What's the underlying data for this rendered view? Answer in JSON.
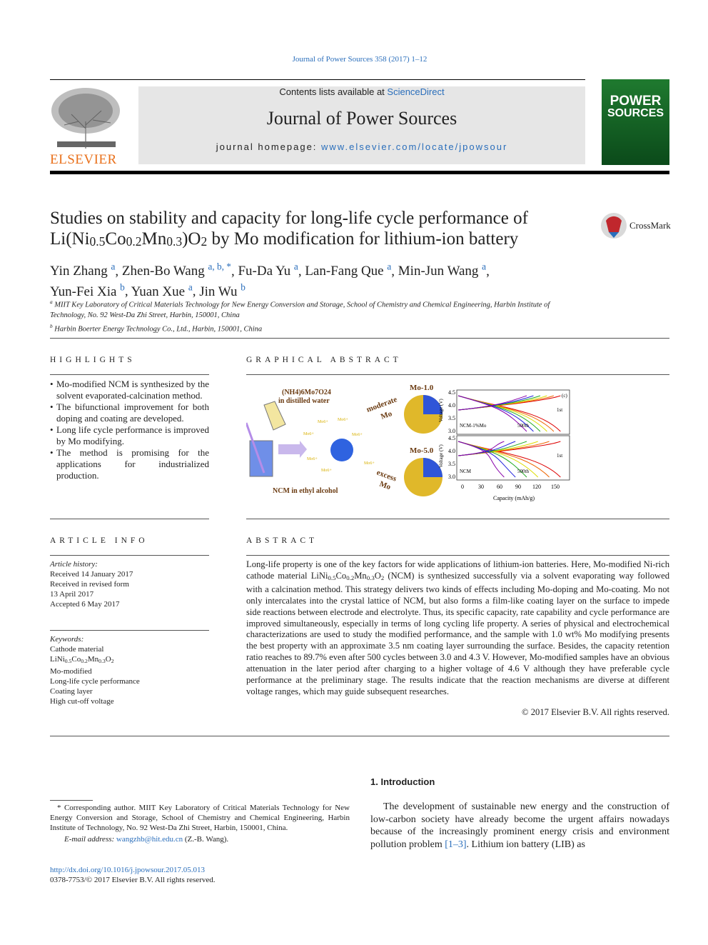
{
  "journal_ref": "Journal of Power Sources 358 (2017) 1–12",
  "header": {
    "contents_prefix": "Contents lists available at ",
    "sciencedirect": "ScienceDirect",
    "journal_title": "Journal of Power Sources",
    "homepage_prefix": "journal homepage: ",
    "homepage_url": "www.elsevier.com/locate/jpowsour",
    "publisher": "ELSEVIER",
    "cover_title_1": "POWER",
    "cover_title_2": "SOURCES"
  },
  "title": {
    "line1": "Studies on stability and capacity for long-life cycle performance of",
    "line2": "Li(Ni0.5Co0.2Mn0.3)O2 by Mo modification for lithium-ion battery"
  },
  "crossmark": "CrossMark",
  "authors": [
    {
      "name": "Yin Zhang",
      "aff": "a"
    },
    {
      "name": "Zhen-Bo Wang",
      "aff": "a, b, *"
    },
    {
      "name": "Fu-Da Yu",
      "aff": "a"
    },
    {
      "name": "Lan-Fang Que",
      "aff": "a"
    },
    {
      "name": "Min-Jun Wang",
      "aff": "a"
    },
    {
      "name": "Yun-Fei Xia",
      "aff": "b"
    },
    {
      "name": "Yuan Xue",
      "aff": "a"
    },
    {
      "name": "Jin Wu",
      "aff": "b"
    }
  ],
  "affiliations": [
    {
      "mark": "a",
      "text": "MIIT Key Laboratory of Critical Materials Technology for New Energy Conversion and Storage, School of Chemistry and Chemical Engineering, Harbin Institute of Technology, No. 92 West-Da Zhi Street, Harbin, 150001, China"
    },
    {
      "mark": "b",
      "text": "Harbin Boerter Energy Technology Co., Ltd., Harbin, 150001, China"
    }
  ],
  "highlights": {
    "heading": "HIGHLIGHTS",
    "items": [
      "Mo-modified NCM is synthesized by the solvent evaporated-calcination method.",
      "The bifunctional improvement for both doping and coating are developed.",
      "Long life cycle performance is improved by Mo modifying.",
      "The method is promising for the applications for industrialized production."
    ]
  },
  "graphical_abstract": {
    "heading": "GRAPHICAL ABSTRACT",
    "labels": {
      "precursor": "(NH4)6Mo7O24",
      "precursor_2": "in distilled water",
      "ncm": "NCM in ethyl alcohol",
      "moderate": "moderate",
      "excess": "excess",
      "mo": "Mo",
      "mo1": "Mo-1.0",
      "mo5": "Mo-5.0",
      "ion": "Mo6+",
      "panel_top": "NCM-1%Mo",
      "panel_bottom": "NCM",
      "tag": "(c)",
      "first": "1st",
      "last": "500th",
      "ylabel": "Voltage (V)",
      "xlabel": "Capacity (mAh/g)",
      "xticks": [
        "0",
        "30",
        "60",
        "90",
        "120",
        "150"
      ],
      "yticks": [
        "4.5",
        "4.0",
        "3.5",
        "3.0"
      ]
    }
  },
  "article_info": {
    "heading": "ARTICLE INFO",
    "history_label": "Article history:",
    "history": [
      "Received 14 January 2017",
      "Received in revised form",
      "13 April 2017",
      "Accepted 6 May 2017"
    ],
    "keywords_label": "Keywords:",
    "keywords": [
      "Cathode material",
      "LiNi0.5Co0.2Mn0.3O2",
      "Mo-modified",
      "Long-life cycle performance",
      "Coating layer",
      "High cut-off voltage"
    ]
  },
  "abstract": {
    "heading": "ABSTRACT",
    "text": "Long-life property is one of the key factors for wide applications of lithium-ion batteries. Here, Mo-modified Ni-rich cathode material LiNi0.5Co0.2Mn0.3O2 (NCM) is synthesized successfully via a solvent evaporating way followed with a calcination method. This strategy delivers two kinds of effects including Mo-doping and Mo-coating. Mo not only intercalates into the crystal lattice of NCM, but also forms a film-like coating layer on the surface to impede side reactions between electrode and electrolyte. Thus, its specific capacity, rate capability and cycle performance are improved simultaneously, especially in terms of long cycling life property. A series of physical and electrochemical characterizations are used to study the modified performance, and the sample with 1.0 wt% Mo modifying presents the best property with an approximate 3.5 nm coating layer surrounding the surface. Besides, the capacity retention ratio reaches to 89.7% even after 500 cycles between 3.0 and 4.3 V. However, Mo-modified samples have an obvious attenuation in the later period after charging to a higher voltage of 4.6 V although they have preferable cycle performance at the preliminary stage. The results indicate that the reaction mechanisms are diverse at different voltage ranges, which may guide subsequent researches.",
    "copyright": "© 2017 Elsevier B.V. All rights reserved."
  },
  "footnote": {
    "text": "* Corresponding author. MIIT Key Laboratory of Critical Materials Technology for New Energy Conversion and Storage, School of Chemistry and Chemical Engineering, Harbin Institute of Technology, No. 92 West-Da Zhi Street, Harbin, 150001, China.",
    "email_label": "E-mail address: ",
    "email": "wangzhb@hit.edu.cn",
    "email_suffix": " (Z.-B. Wang)."
  },
  "doi": "http://dx.doi.org/10.1016/j.jpowsour.2017.05.013",
  "issn": "0378-7753/© 2017 Elsevier B.V. All rights reserved.",
  "intro": {
    "heading": "1.  Introduction",
    "text_before": "The development of sustainable new energy and the construction of low-carbon society have already become the urgent affairs nowadays because of the increasingly prominent energy crisis and environment pollution problem ",
    "cite": "[1–3]",
    "text_after": ". Lithium ion battery (LIB) as"
  }
}
